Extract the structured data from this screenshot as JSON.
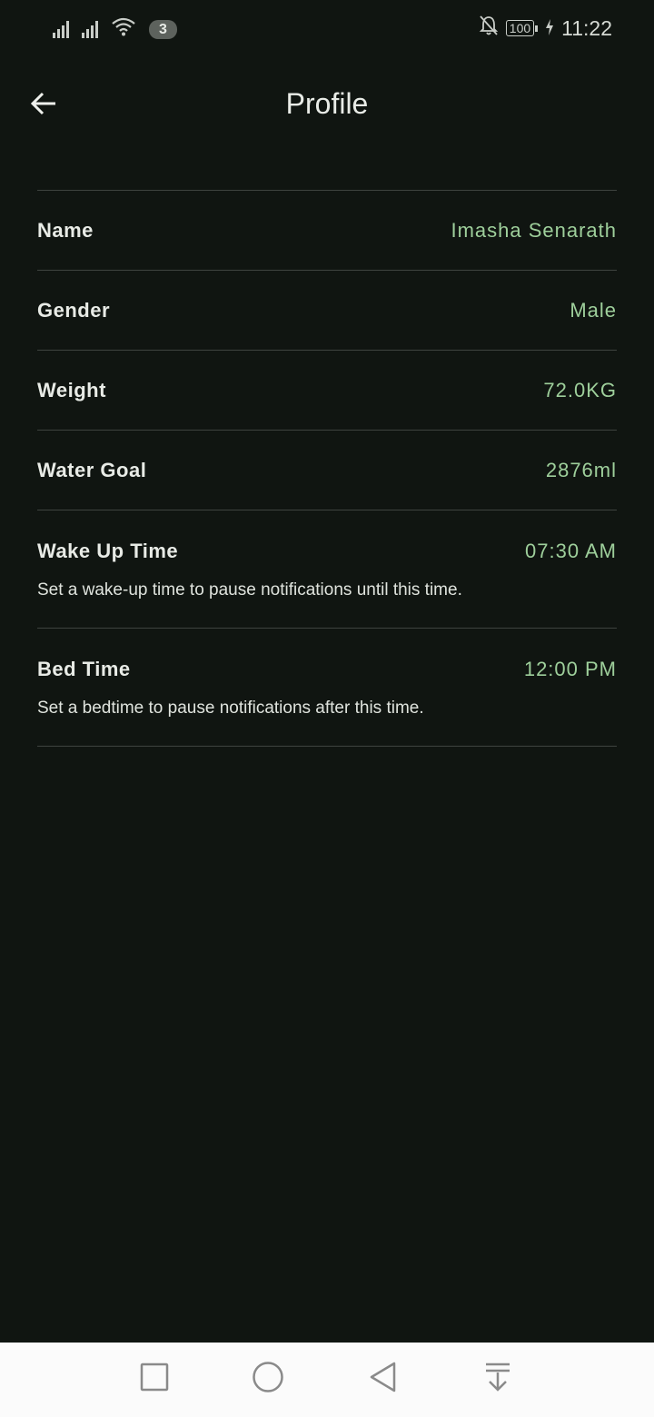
{
  "status_bar": {
    "notification_count": "3",
    "battery": "100",
    "time": "11:22",
    "icons": [
      "signal-icon",
      "signal-icon",
      "wifi-icon",
      "mute-bell-icon",
      "battery-icon",
      "charging-icon"
    ]
  },
  "app_bar": {
    "title": "Profile",
    "back_icon": "arrow-left-icon"
  },
  "profile": {
    "name": {
      "label": "Name",
      "value": "Imasha Senarath"
    },
    "gender": {
      "label": "Gender",
      "value": "Male"
    },
    "weight": {
      "label": "Weight",
      "value": "72.0KG"
    },
    "water_goal": {
      "label": "Water Goal",
      "value": "2876ml"
    },
    "wake_up": {
      "label": "Wake Up Time",
      "value": "07:30 AM",
      "description": "Set a wake-up time to pause notifications until this time."
    },
    "bed_time": {
      "label": "Bed Time",
      "value": "12:00 PM",
      "description": "Set a bedtime to pause notifications after this time."
    }
  },
  "nav_bar": {
    "icons": [
      "recents-square-icon",
      "home-circle-icon",
      "back-triangle-icon",
      "notification-pull-down-icon"
    ]
  },
  "colors": {
    "background": "#101511",
    "accent_value": "#9ecf9b",
    "divider": "#3e433f",
    "nav_background": "#fbfbfb"
  }
}
